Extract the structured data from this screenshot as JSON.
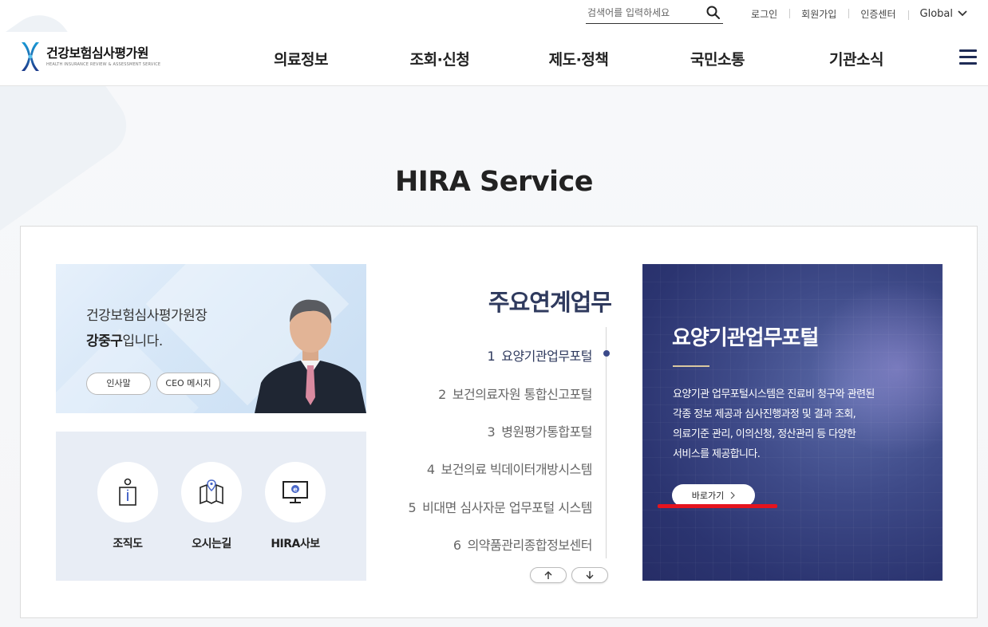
{
  "utility": {
    "search_placeholder": "검색어를 입력하세요",
    "links": [
      "로그인",
      "회원가입",
      "인증센터"
    ],
    "global_label": "Global"
  },
  "logo": {
    "title": "건강보험심사평가원",
    "subtitle": "HEALTH INSURANCE REVIEW & ASSESSMENT SERVICE"
  },
  "gnb": [
    "의료정보",
    "조회·신청",
    "제도·정책",
    "국민소통",
    "기관소식"
  ],
  "section_title": "HIRA Service",
  "ceo": {
    "line1": "건강보험심사평가원장",
    "name": "강중구",
    "suffix": "입니다.",
    "greeting_button": "인사말",
    "message_button": "CEO 메시지"
  },
  "quick_links": [
    {
      "label": "조직도",
      "icon": "org-chart-icon"
    },
    {
      "label": "오시는길",
      "icon": "map-icon"
    },
    {
      "label": "HIRA사보",
      "icon": "newsletter-monitor-icon"
    }
  ],
  "links": {
    "title": "주요연계업무",
    "items": [
      {
        "num": "1",
        "label": "요양기관업무포털",
        "active": true
      },
      {
        "num": "2",
        "label": "보건의료자원 통합신고포털"
      },
      {
        "num": "3",
        "label": "병원평가통합포털"
      },
      {
        "num": "4",
        "label": "보건의료 빅데이터개방시스템"
      },
      {
        "num": "5",
        "label": "비대면 심사자문 업무포털 시스템"
      },
      {
        "num": "6",
        "label": "의약품관리종합정보센터"
      }
    ]
  },
  "feature": {
    "title": "요양기관업무포털",
    "desc": [
      "요양기관 업무포털시스템은 진료비 청구와 관련된",
      "각종 정보 제공과 심사진행과정 및 결과 조회,",
      "의료기준 관리, 이의신청, 정산관리 등 다양한",
      "서비스를 제공합니다."
    ],
    "button": "바로가기",
    "accent_color": "#e5141e"
  }
}
